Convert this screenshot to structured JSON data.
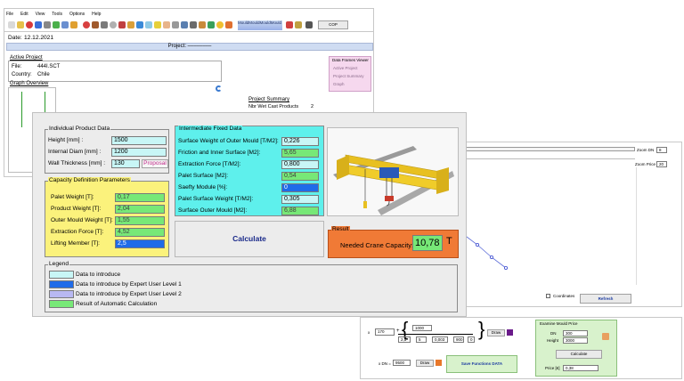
{
  "main_window": {
    "menu": [
      "File",
      "Edit",
      "View",
      "Tools",
      "Options",
      "Help"
    ],
    "banner_text": "MouldMouldMouldMould",
    "cop_label": "COP",
    "date_label": "Date:",
    "date_value": "12.12.2021",
    "project_label": "Project: ––––––––",
    "active_project": {
      "title": "Active Project",
      "file_label": "File:",
      "file_value": "444I.SCT",
      "country_label": "Country:",
      "country_value": "Chile"
    },
    "data_frames": {
      "title": "Data Frames Viewer",
      "items": [
        "Active Project",
        "Project Summary",
        "Graph"
      ]
    },
    "graph_overview": "Graph Overview",
    "project_summary": {
      "title": "Project Summary",
      "row_label": "Nbr Wet Cast Products",
      "row_value": "2"
    }
  },
  "dialog": {
    "individual": {
      "title": "Individual Product Data",
      "height_label": "Height [mm] :",
      "height_value": "1500",
      "diam_label": "Internal Diam [mm] :",
      "diam_value": "1200",
      "wall_label": "Wall Thickness [mm] :",
      "wall_value": "130",
      "proposal_label": "Proposal"
    },
    "capacity": {
      "title": "Capacity Definition Parameters",
      "rows": [
        {
          "label": "Palet Weight [T]:",
          "value": "0,17"
        },
        {
          "label": "Product Weight [T]:",
          "value": "2,04"
        },
        {
          "label": "Outer Mould Weight [T]:",
          "value": "1,55"
        },
        {
          "label": "Extraction Force [T]:",
          "value": "4,52"
        },
        {
          "label": "Lifting Member [T]:",
          "value": "2,5"
        }
      ]
    },
    "intermediate": {
      "title": "Intermediate Fixed Data",
      "rows": [
        {
          "label": "Surface Weight of Outer Mould [T/M2]:",
          "value": "0,226"
        },
        {
          "label": "Friction and Inner Surface [M2]:",
          "value": "5,65"
        },
        {
          "label": "Extraction Force [T/M2]:",
          "value": "0,800"
        },
        {
          "label": "Palet Surface [M2]:",
          "value": "0,54"
        },
        {
          "label": "Saefty Module [%]:",
          "value": "0"
        },
        {
          "label": "Palet Surface Weight [T/M2]:",
          "value": "0,305"
        },
        {
          "label": "Surface Outer Mould [M2]:",
          "value": "6,88"
        }
      ]
    },
    "calculate_label": "Calculate",
    "result": {
      "title": "Result",
      "label": "Needed Crane Capacity:",
      "value": "10,78",
      "unit": "T"
    },
    "legend": {
      "title": "Legend",
      "items": [
        {
          "label": "Data to introduce",
          "color": "#c8f6f6"
        },
        {
          "label": "Data to introduce by Expert User Level 1",
          "color": "#1f6be8"
        },
        {
          "label": "Data to introduce by Expert User Level 2",
          "color": "#b8b8f2"
        },
        {
          "label": "Result of Automatic Calculation",
          "color": "#77e877"
        }
      ]
    }
  },
  "back_window": {
    "zoom_dn_label": "Zoom DN",
    "zoom_dn_value": "8",
    "zoom_price_label": "Zoom Price",
    "zoom_price_value": "20",
    "coordinates_label": "Coordinates",
    "refresh_label": "Refresh",
    "formula": {
      "v1": "170",
      "v2": "1000",
      "v3": "2,5",
      "v4": "5",
      "v5": "0,003",
      "v6": "900",
      "v7": "0",
      "draw_label": "Draw"
    },
    "dn_label": "x DN =",
    "dn_value": "9500",
    "draw2_label": "Draw",
    "save_label": "Save Functions DATA",
    "examine": {
      "title": "Examine Mould Price",
      "dn_label": "DN",
      "dn_value": "300",
      "height_label": "Height",
      "height_value": "3000",
      "calc_label": "Calculate",
      "price_label": "Price [€]",
      "price_value": "0,38"
    }
  }
}
